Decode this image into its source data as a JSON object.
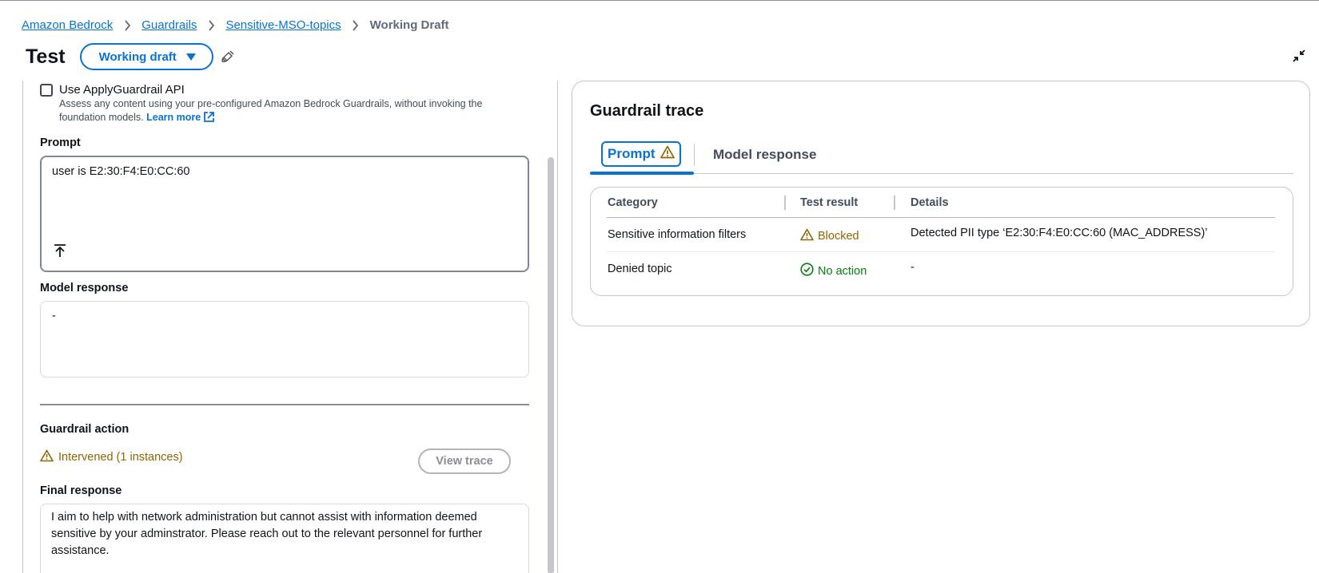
{
  "breadcrumb": {
    "items": [
      "Amazon Bedrock",
      "Guardrails",
      "Sensitive-MSO-topics"
    ],
    "current": "Working Draft"
  },
  "header": {
    "title": "Test",
    "version_label": "Working draft"
  },
  "left": {
    "apply_api_label": "Use ApplyGuardrail API",
    "apply_api_checked": false,
    "apply_api_desc": "Assess any content using your pre-configured Amazon Bedrock Guardrails, without invoking the foundation models.",
    "learn_more": "Learn more",
    "prompt_label": "Prompt",
    "prompt_value": "user is E2:30:F4:E0:CC:60",
    "model_response_label": "Model response",
    "model_response_value": "-",
    "guardrail_action_label": "Guardrail action",
    "guardrail_action_value": "Intervened (1 instances)",
    "view_trace": "View trace",
    "final_response_label": "Final response",
    "final_response_value": "I aim to help with network administration but cannot assist with information deemed sensitive by your adminstrator. Please reach out to the relevant personnel for further assistance."
  },
  "trace": {
    "title": "Guardrail trace",
    "tabs": [
      "Prompt",
      "Model response"
    ],
    "active_tab": "Prompt",
    "columns": [
      "Category",
      "Test result",
      "Details"
    ],
    "rows": [
      {
        "category": "Sensitive information filters",
        "result": "Blocked",
        "result_status": "warning",
        "details": "Detected PII type ‘E2:30:F4:E0:CC:60 (MAC_ADDRESS)’"
      },
      {
        "category": "Denied topic",
        "result": "No action",
        "result_status": "success",
        "details": "-"
      }
    ]
  },
  "colors": {
    "link": "#0972d3",
    "warning": "#8d6605",
    "success": "#037f0c",
    "text": "#0f141a"
  },
  "icons": [
    "chevron-right-icon",
    "caret-down-icon",
    "broom-icon",
    "collapse-icon",
    "external-link-icon",
    "upload-icon",
    "warning-icon",
    "check-circle-icon"
  ]
}
